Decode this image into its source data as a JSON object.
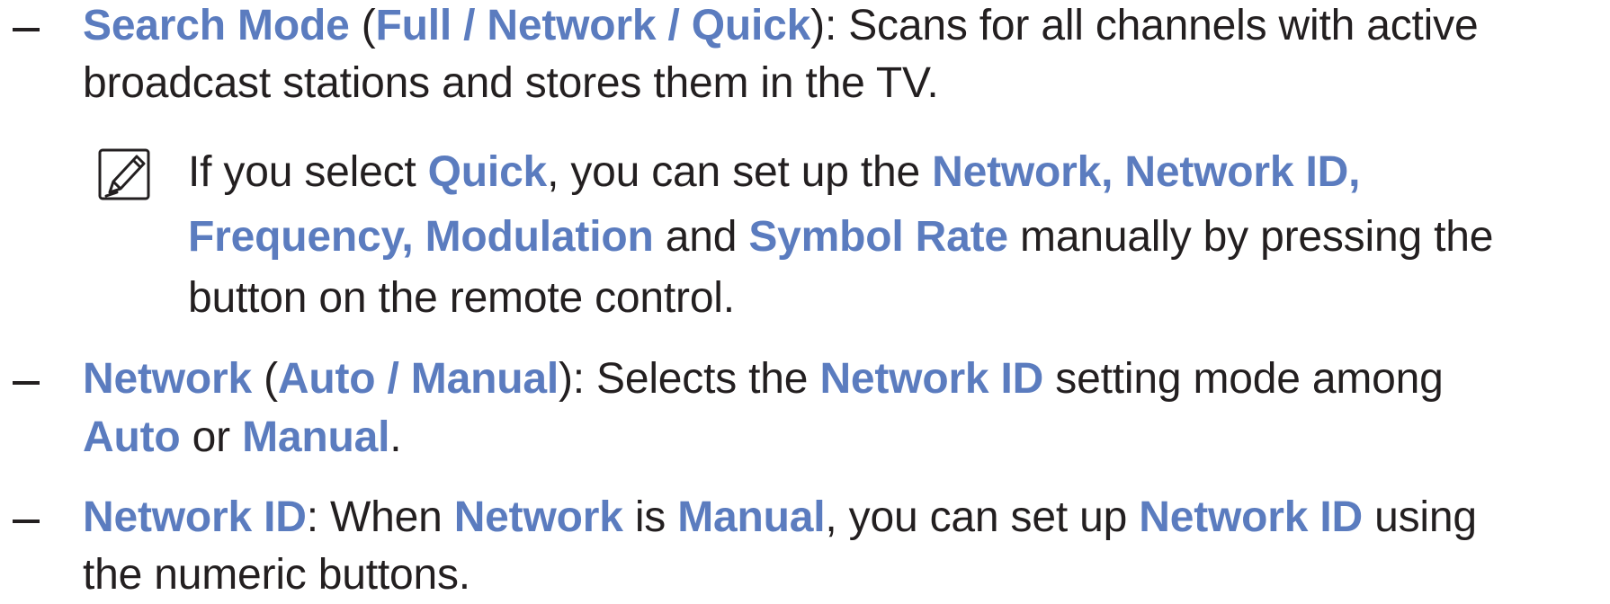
{
  "items": [
    {
      "id": "search-mode",
      "lines": [
        [
          {
            "text": "Search Mode",
            "style": "b"
          },
          {
            "text": " (",
            "style": "n"
          },
          {
            "text": "Full / Network / Quick",
            "style": "b"
          },
          {
            "text": "): Scans for all channels with active",
            "style": "n"
          }
        ],
        [
          {
            "text": "broadcast stations and stores them in the TV.",
            "style": "n"
          }
        ]
      ]
    },
    {
      "id": "network",
      "lines": [
        [
          {
            "text": "Network",
            "style": "b"
          },
          {
            "text": " (",
            "style": "n"
          },
          {
            "text": "Auto / Manual",
            "style": "b"
          },
          {
            "text": "): Selects the ",
            "style": "n"
          },
          {
            "text": "Network ID",
            "style": "b"
          },
          {
            "text": " setting mode among",
            "style": "n"
          }
        ],
        [
          {
            "text": "Auto",
            "style": "b"
          },
          {
            "text": " or ",
            "style": "n"
          },
          {
            "text": "Manual",
            "style": "b"
          },
          {
            "text": ".",
            "style": "n"
          }
        ]
      ]
    },
    {
      "id": "network-id",
      "lines": [
        [
          {
            "text": "Network ID",
            "style": "b"
          },
          {
            "text": ": When ",
            "style": "n"
          },
          {
            "text": "Network",
            "style": "b"
          },
          {
            "text": " is ",
            "style": "n"
          },
          {
            "text": "Manual",
            "style": "b"
          },
          {
            "text": ", you can set up ",
            "style": "n"
          },
          {
            "text": "Network ID",
            "style": "b"
          },
          {
            "text": " using",
            "style": "n"
          }
        ],
        [
          {
            "text": "the numeric buttons.",
            "style": "n"
          }
        ]
      ]
    }
  ],
  "note": {
    "icon": "note-icon",
    "lines": [
      [
        {
          "text": "If you select ",
          "style": "n"
        },
        {
          "text": "Quick",
          "style": "b"
        },
        {
          "text": ", you can set up the ",
          "style": "n"
        },
        {
          "text": "Network, Network ID,",
          "style": "b"
        }
      ],
      [
        {
          "text": "Frequency, Modulation",
          "style": "b"
        },
        {
          "text": " and ",
          "style": "n"
        },
        {
          "text": "Symbol Rate",
          "style": "b"
        },
        {
          "text": " manually by pressing the",
          "style": "n"
        }
      ],
      [
        {
          "text": "button on the remote control.",
          "style": "n"
        }
      ]
    ]
  },
  "colors": {
    "accent": "#5b7cbf",
    "text": "#231f20"
  }
}
